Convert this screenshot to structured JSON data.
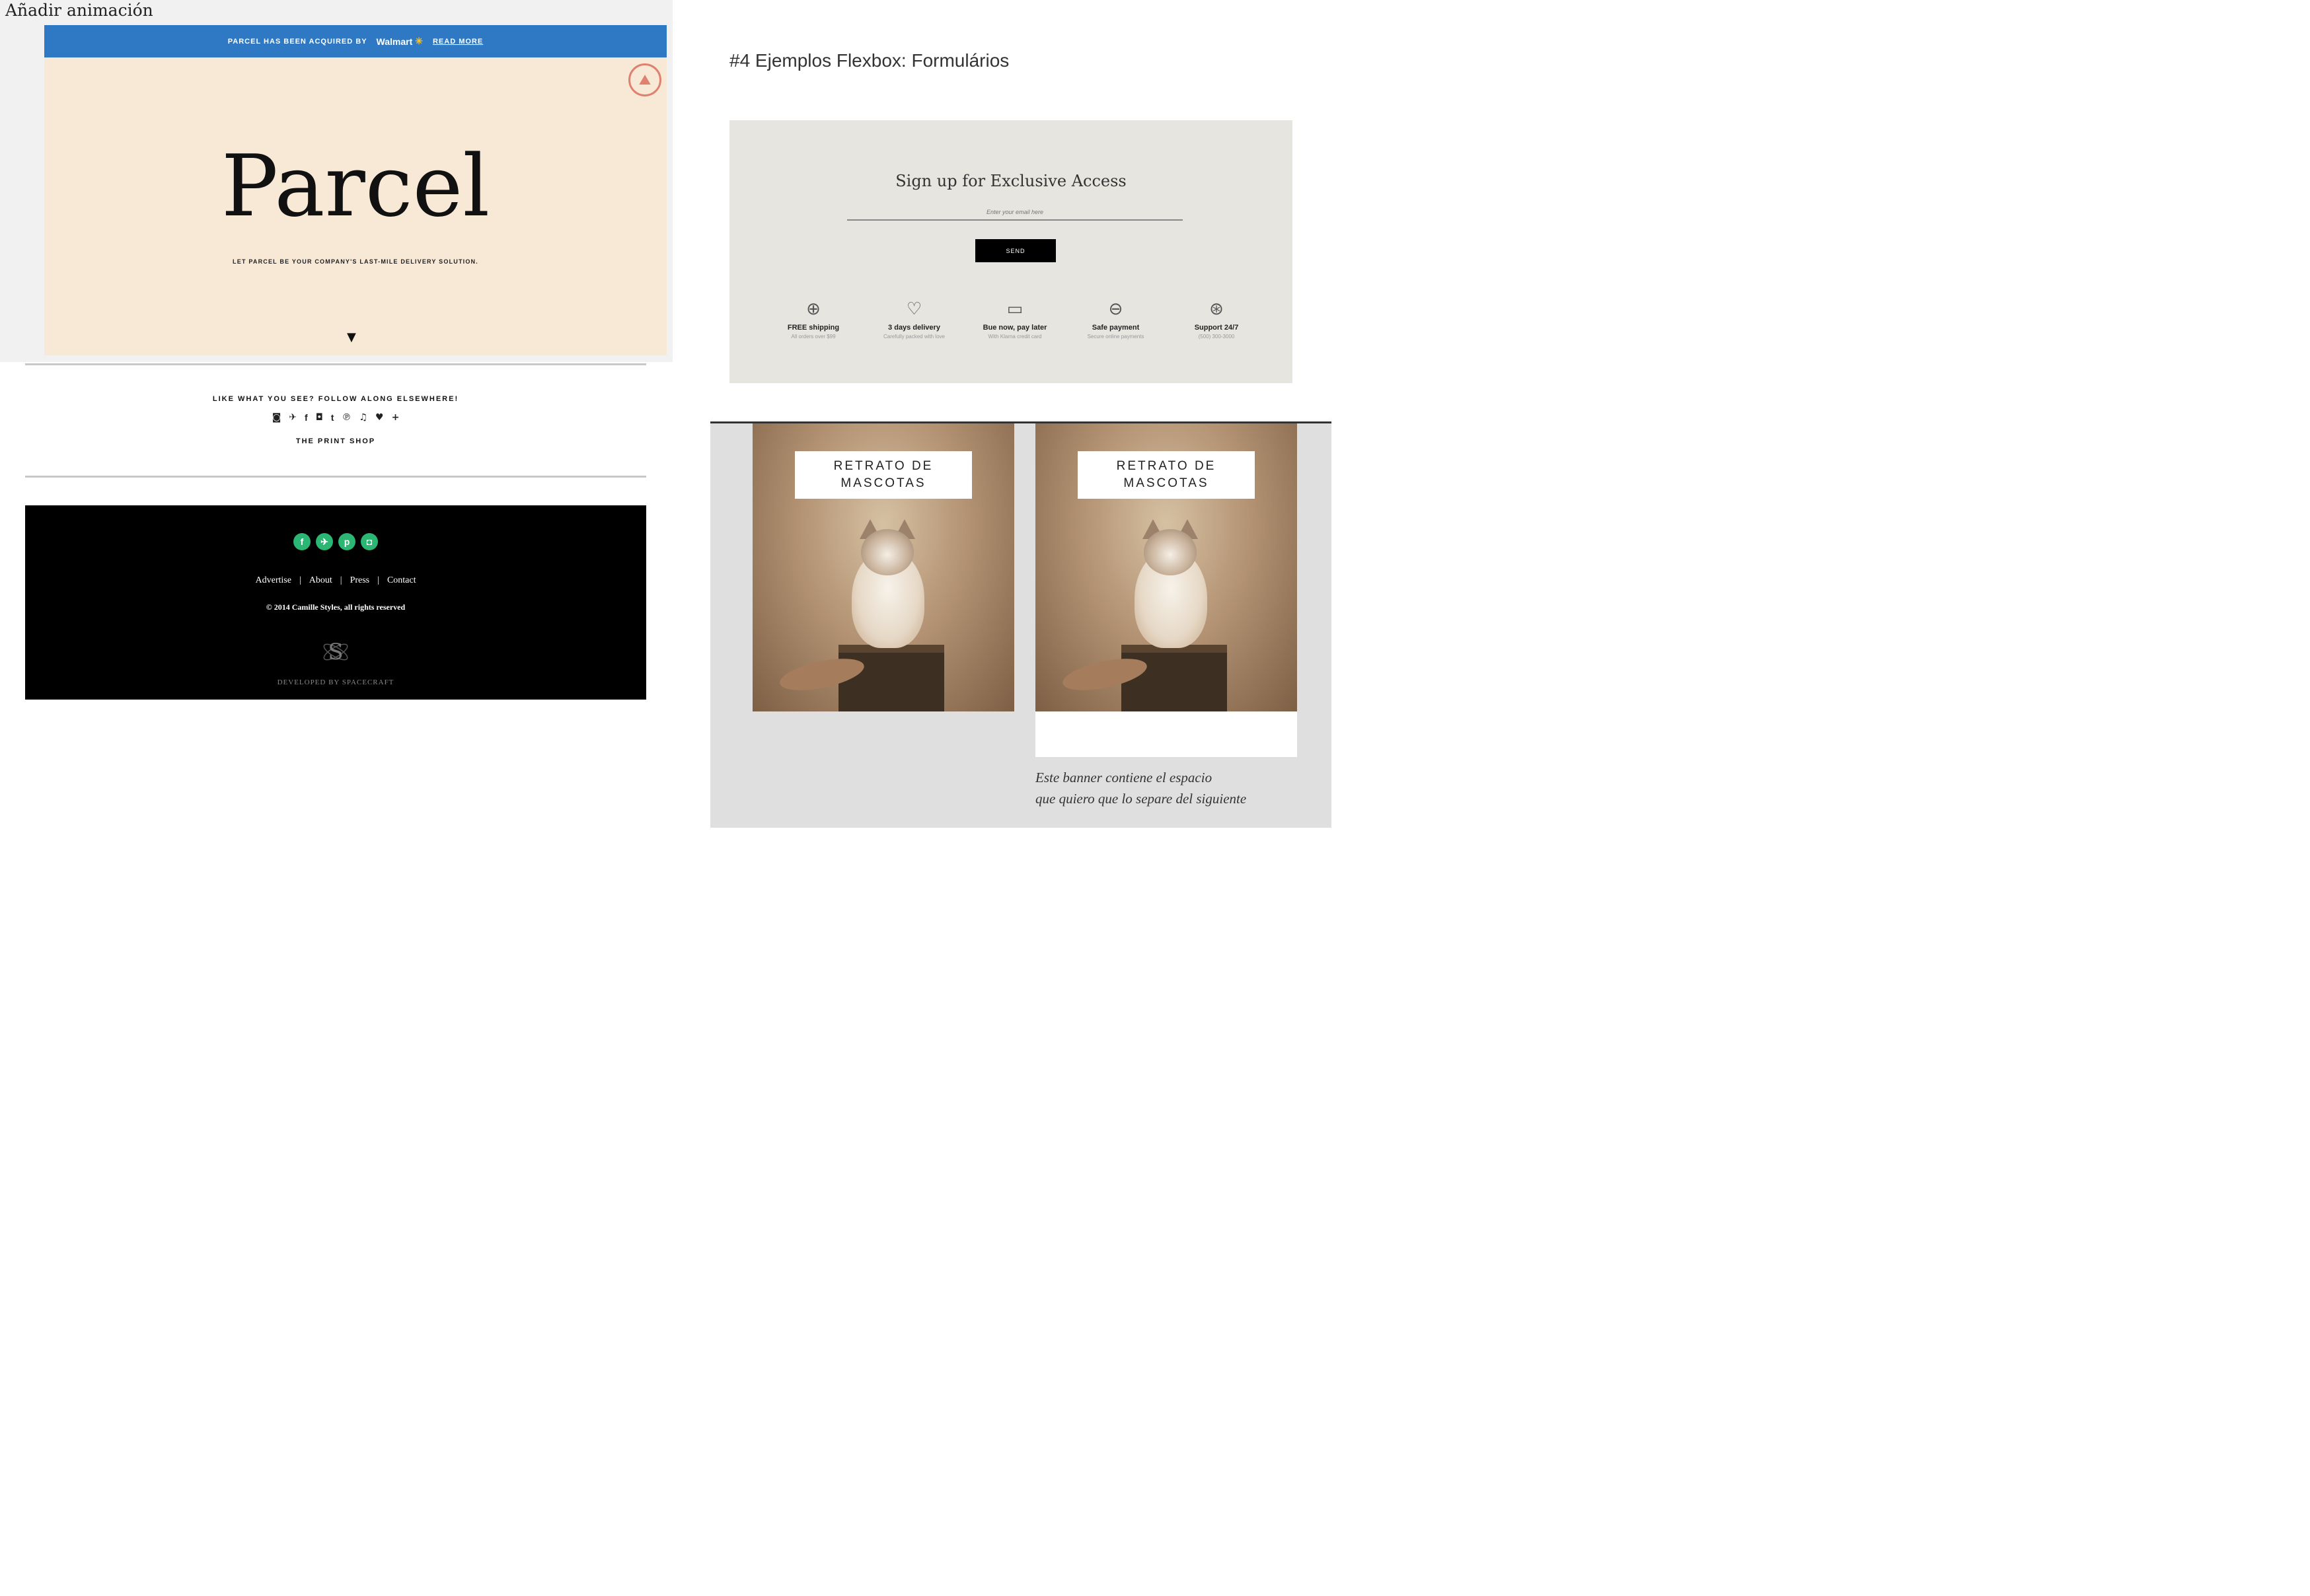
{
  "toolbar": {
    "label": "Añadir animación"
  },
  "parcel": {
    "banner_text": "PARCEL HAS BEEN ACQUIRED BY",
    "banner_brand": "Walmart",
    "banner_link": "READ MORE",
    "title": "Parcel",
    "tagline": "LET PARCEL BE YOUR COMPANY'S LAST-MILE DELIVERY SOLUTION."
  },
  "follow": {
    "heading": "LIKE WHAT YOU SEE? FOLLOW ALONG ELSEWHERE!",
    "icons": [
      "rss-icon",
      "twitter-icon",
      "facebook-icon",
      "instagram-icon",
      "tumblr-icon",
      "pinterest-icon",
      "music-icon",
      "heart-icon",
      "plus-icon"
    ],
    "print_shop": "THE PRINT SHOP"
  },
  "footer": {
    "social_icons": [
      "facebook-icon",
      "twitter-icon",
      "pinterest-icon",
      "instagram-icon"
    ],
    "links": [
      "Advertise",
      "About",
      "Press",
      "Contact"
    ],
    "copyright": "© 2014 Camille Styles, all rights reserved",
    "developed": "DEVELOPED BY SPACECRAFT",
    "colors": {
      "background": "#000000",
      "social": "#2bb673"
    }
  },
  "right": {
    "heading": "#4 Ejemplos Flexbox: Formulários"
  },
  "signup": {
    "title": "Sign up for Exclusive Access",
    "email_placeholder": "Enter your email here",
    "send_label": "SEND",
    "features": [
      {
        "icon": "globe-icon",
        "title": "FREE shipping",
        "subtitle": "All orders over $99"
      },
      {
        "icon": "heart-icon",
        "title": "3 days delivery",
        "subtitle": "Carefully packed with love"
      },
      {
        "icon": "wallet-icon",
        "title": "Bue now, pay later",
        "subtitle": "With Klarna credit card"
      },
      {
        "icon": "lock-icon",
        "title": "Safe payment",
        "subtitle": "Secure online payments"
      },
      {
        "icon": "lifebuoy-icon",
        "title": "Support 24/7",
        "subtitle": "(500) 300-3000"
      }
    ]
  },
  "banner": {
    "cards": [
      {
        "label": "RETRATO DE\nMASCOTAS"
      },
      {
        "label": "RETRATO DE\nMASCOTAS"
      }
    ],
    "note": "Este banner contiene el espacio\nque quiero que lo separe del siguiente"
  }
}
